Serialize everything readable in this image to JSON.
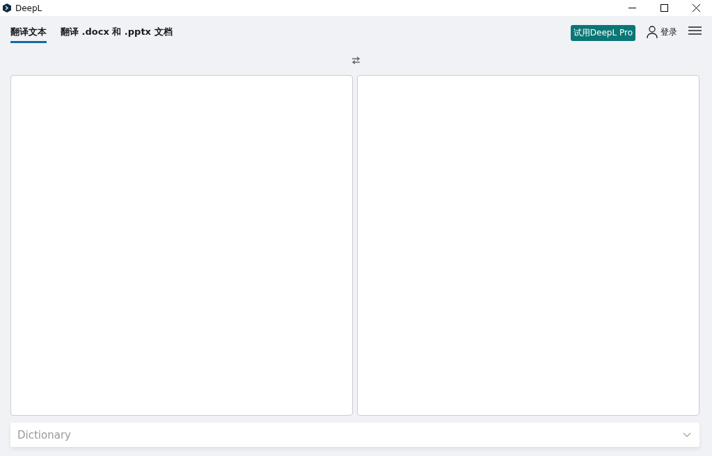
{
  "window": {
    "title": "DeepL"
  },
  "tabs": [
    {
      "label": "翻译文本",
      "selected": true
    },
    {
      "label": "翻译 .docx 和 .pptx 文档",
      "selected": false
    }
  ],
  "pro_button": "试用DeepL Pro",
  "login": "登录",
  "dictionary": {
    "label": "Dictionary",
    "expanded": false
  }
}
